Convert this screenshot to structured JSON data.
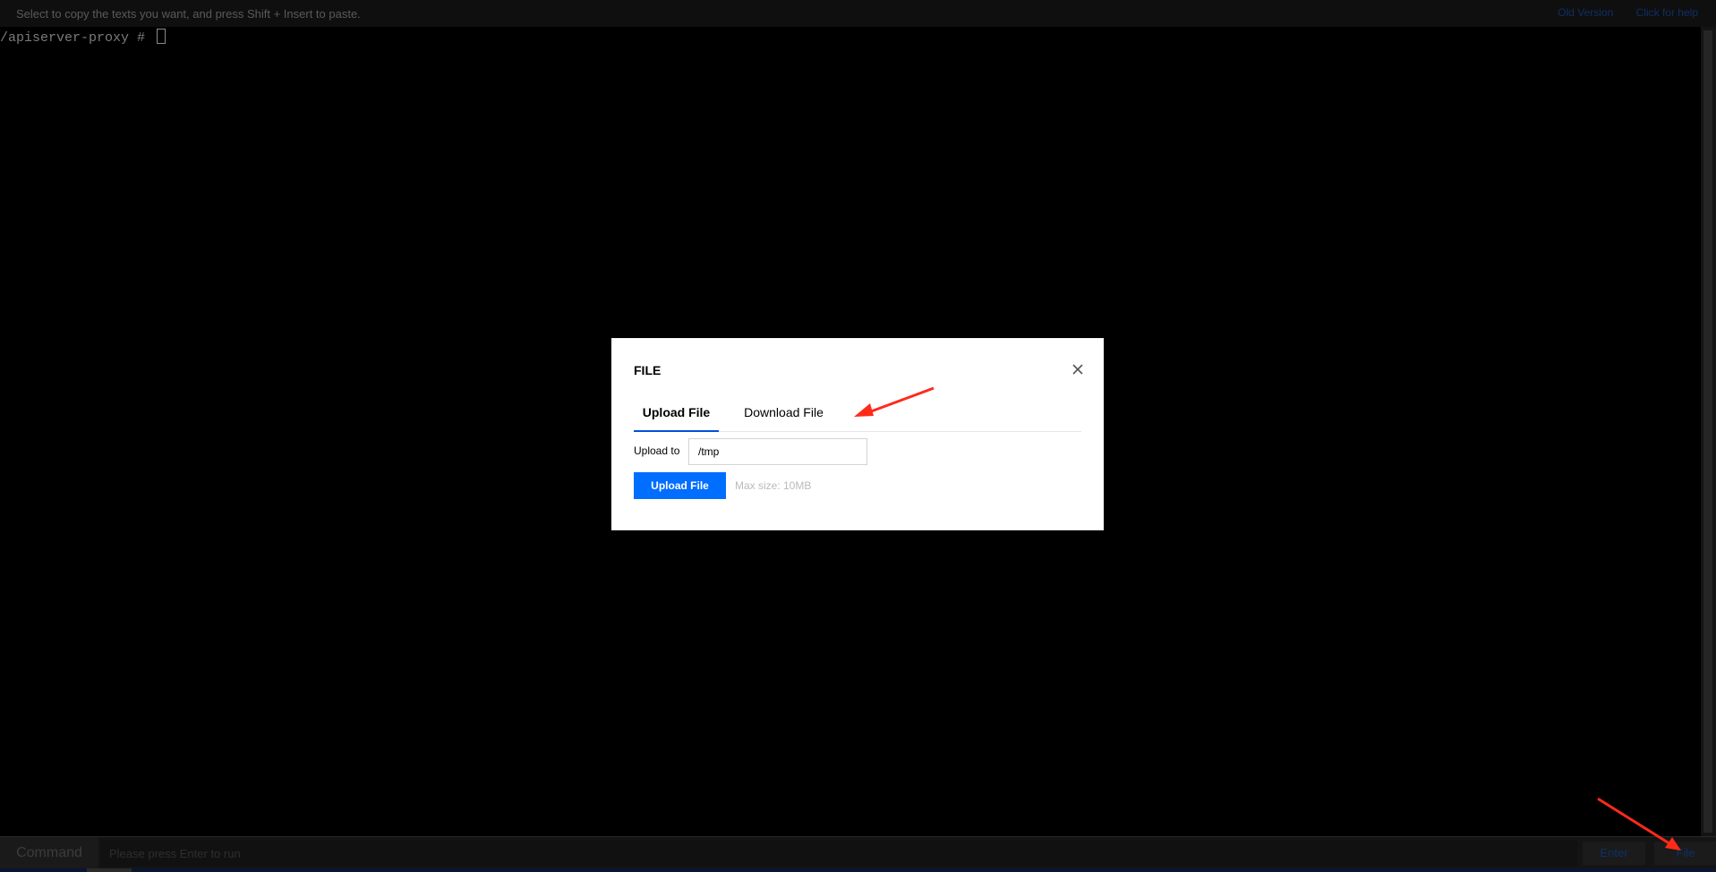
{
  "topbar": {
    "hint": "Select to copy the texts you want, and press Shift + Insert to paste.",
    "links": [
      "Old Version",
      "Click for help"
    ]
  },
  "terminal": {
    "prompt": "/apiserver-proxy # "
  },
  "commandbar": {
    "label": "Command",
    "placeholder": "Please press Enter to run",
    "enter": "Enter",
    "file": "File"
  },
  "modal": {
    "title": "FILE",
    "tabs": [
      {
        "label": "Upload File",
        "active": true
      },
      {
        "label": "Download File",
        "active": false
      }
    ],
    "upload_label": "Upload to",
    "upload_path": "/tmp",
    "upload_button": "Upload File",
    "max_size": "Max size: 10MB"
  },
  "colors": {
    "accent": "#006eff",
    "tab_underline": "#0052d9",
    "annotation": "#ff2a1a",
    "background": "#000000"
  },
  "icons": {
    "close": "close-icon",
    "arrow_tabs": "annotation-arrow-icon",
    "arrow_file": "annotation-arrow-icon"
  }
}
